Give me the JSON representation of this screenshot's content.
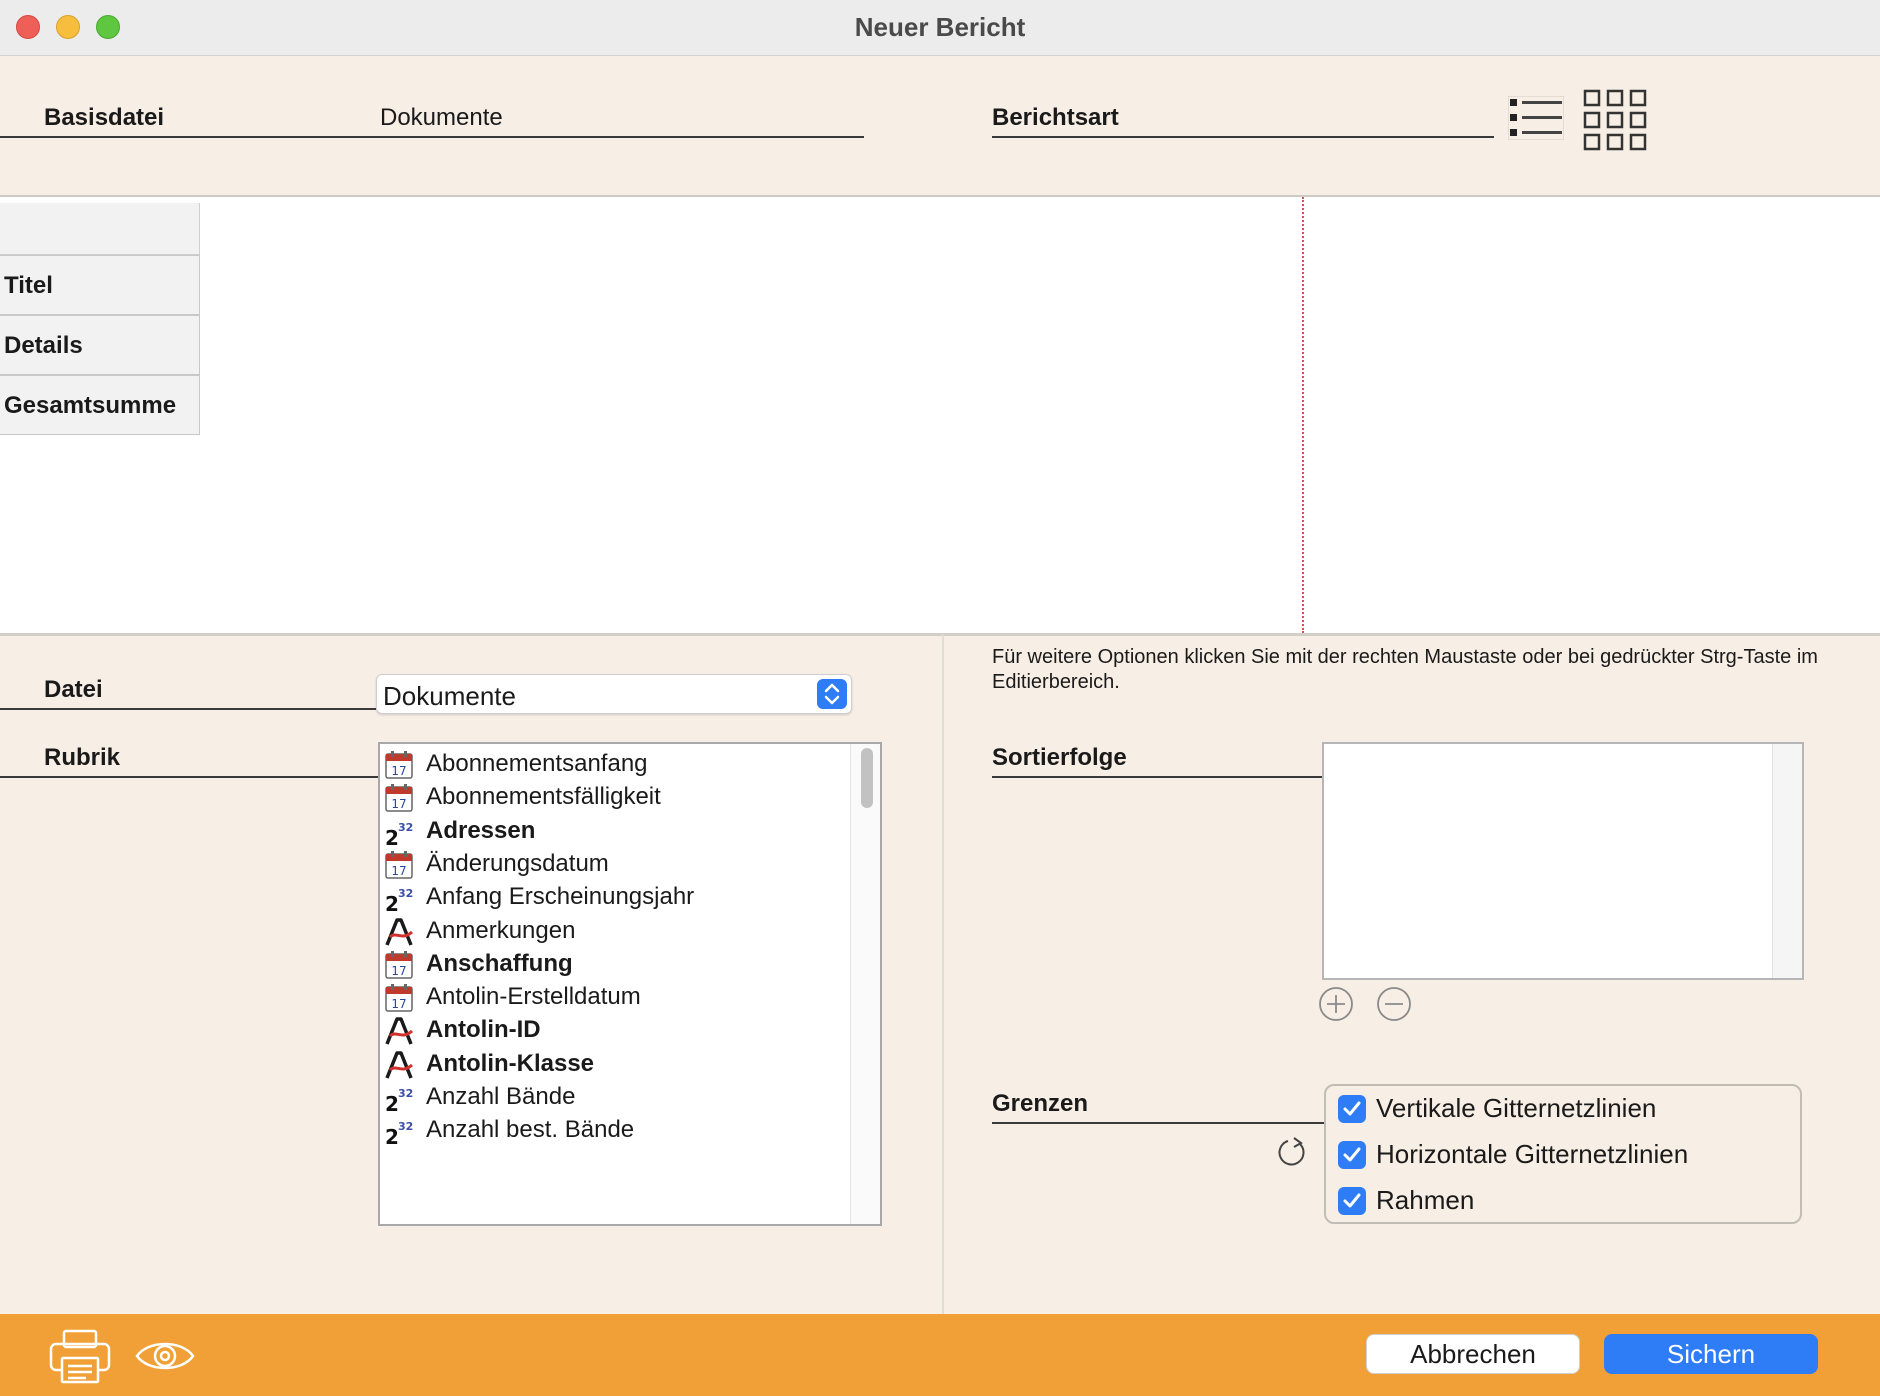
{
  "window": {
    "title": "Neuer Bericht"
  },
  "header": {
    "basisdatei_label": "Basisdatei",
    "basisdatei_value": "Dokumente",
    "berichtsart_label": "Berichtsart"
  },
  "sections": {
    "titel": "Titel",
    "details": "Details",
    "gesamtsumme": "Gesamtsumme"
  },
  "form": {
    "datei_label": "Datei",
    "datei_value": "Dokumente",
    "rubrik_label": "Rubrik",
    "rubrik_items": [
      {
        "label": "Abonnementsanfang",
        "icon": "calendar-icon",
        "bold": false
      },
      {
        "label": "Abonnementsfälligkeit",
        "icon": "calendar-icon",
        "bold": false
      },
      {
        "label": "Adressen",
        "icon": "number-icon",
        "bold": true
      },
      {
        "label": "Änderungsdatum",
        "icon": "calendar-icon",
        "bold": false
      },
      {
        "label": "Anfang Erscheinungsjahr",
        "icon": "number-icon",
        "bold": false
      },
      {
        "label": "Anmerkungen",
        "icon": "text-icon",
        "bold": false
      },
      {
        "label": "Anschaffung",
        "icon": "calendar-icon",
        "bold": true
      },
      {
        "label": "Antolin-Erstelldatum",
        "icon": "calendar-icon",
        "bold": false
      },
      {
        "label": "Antolin-ID",
        "icon": "text-icon",
        "bold": true
      },
      {
        "label": "Antolin-Klasse",
        "icon": "text-icon",
        "bold": true
      },
      {
        "label": "Anzahl Bände",
        "icon": "number-icon",
        "bold": false
      },
      {
        "label": "Anzahl best. Bände",
        "icon": "number-icon",
        "bold": false
      }
    ]
  },
  "right": {
    "hint": "Für weitere Optionen klicken Sie mit der rechten Maustaste oder bei gedrückter Strg-Taste im Editierbereich.",
    "sortierfolge_label": "Sortierfolge",
    "grenzen_label": "Grenzen",
    "checkboxes": [
      {
        "label": "Vertikale Gitternetzlinien",
        "checked": true
      },
      {
        "label": "Horizontale Gitternetzlinien",
        "checked": true
      },
      {
        "label": "Rahmen",
        "checked": true
      }
    ]
  },
  "footer": {
    "cancel_label": "Abbrechen",
    "save_label": "Sichern"
  },
  "colors": {
    "footer_bg": "#f1a037",
    "accent": "#2e7cf6",
    "panel_bg": "#f7eee5"
  }
}
